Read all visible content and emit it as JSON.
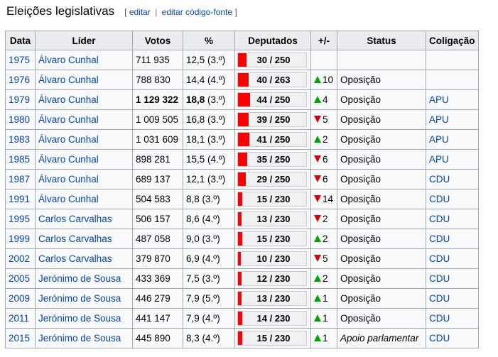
{
  "section": {
    "title": "Eleições legislativas",
    "edit_open": "[",
    "edit_label": "editar",
    "edit_sep": "|",
    "edit_source_label": "editar código-fonte",
    "edit_close": "]"
  },
  "colors": {
    "seat_bar": "#ff0000",
    "gain": "#00a600",
    "loss": "#dd0000",
    "link": "#0645ad"
  },
  "table": {
    "headers": [
      "Data",
      "Líder",
      "Votos",
      "%",
      "Deputados",
      "+/-",
      "Status",
      "Coligação"
    ],
    "rows": [
      {
        "year": "1975",
        "leader": "Álvaro Cunhal",
        "votes": "711 935",
        "pct": "12,5",
        "rank": "(3.º)",
        "seats": 30,
        "total": 250,
        "seats_label": "30 / 250",
        "change_dir": "",
        "change": "",
        "status": "",
        "coalition": ""
      },
      {
        "year": "1976",
        "leader": "Álvaro Cunhal",
        "votes": "788 830",
        "pct": "14,4",
        "rank": "(4.º)",
        "seats": 40,
        "total": 263,
        "seats_label": "40 / 263",
        "change_dir": "up",
        "change": "10",
        "status": "Oposição",
        "coalition": ""
      },
      {
        "year": "1979",
        "leader": "Álvaro Cunhal",
        "votes": "1 129 322",
        "pct": "18,8",
        "rank": "(3.º)",
        "seats": 44,
        "total": 250,
        "seats_label": "44 / 250",
        "change_dir": "up",
        "change": "4",
        "status": "Oposição",
        "coalition": "APU",
        "bold": true
      },
      {
        "year": "1980",
        "leader": "Álvaro Cunhal",
        "votes": "1 009 505",
        "pct": "16,8",
        "rank": "(3.º)",
        "seats": 39,
        "total": 250,
        "seats_label": "39 / 250",
        "change_dir": "down",
        "change": "5",
        "status": "Oposição",
        "coalition": "APU"
      },
      {
        "year": "1983",
        "leader": "Álvaro Cunhal",
        "votes": "1 031 609",
        "pct": "18,1",
        "rank": "(3.º)",
        "seats": 41,
        "total": 250,
        "seats_label": "41 / 250",
        "change_dir": "up",
        "change": "2",
        "status": "Oposição",
        "coalition": "APU"
      },
      {
        "year": "1985",
        "leader": "Álvaro Cunhal",
        "votes": "898 281",
        "pct": "15,5",
        "rank": "(4.º)",
        "seats": 35,
        "total": 250,
        "seats_label": "35 / 250",
        "change_dir": "down",
        "change": "6",
        "status": "Oposição",
        "coalition": "APU"
      },
      {
        "year": "1987",
        "leader": "Álvaro Cunhal",
        "votes": "689 137",
        "pct": "12,1",
        "rank": "(3.º)",
        "seats": 29,
        "total": 250,
        "seats_label": "29 / 250",
        "change_dir": "down",
        "change": "6",
        "status": "Oposição",
        "coalition": "CDU"
      },
      {
        "year": "1991",
        "leader": "Álvaro Cunhal",
        "votes": "504 583",
        "pct": "8,8",
        "rank": "(3.º)",
        "seats": 15,
        "total": 230,
        "seats_label": "15 / 230",
        "change_dir": "down",
        "change": "14",
        "status": "Oposição",
        "coalition": "CDU"
      },
      {
        "year": "1995",
        "leader": "Carlos Carvalhas",
        "votes": "506 157",
        "pct": "8,6",
        "rank": "(4.º)",
        "seats": 13,
        "total": 230,
        "seats_label": "13 / 230",
        "change_dir": "down",
        "change": "2",
        "status": "Oposição",
        "coalition": "CDU"
      },
      {
        "year": "1999",
        "leader": "Carlos Carvalhas",
        "votes": "487 058",
        "pct": "9,0",
        "rank": "(3.º)",
        "seats": 15,
        "total": 230,
        "seats_label": "15 / 230",
        "change_dir": "up",
        "change": "2",
        "status": "Oposição",
        "coalition": "CDU"
      },
      {
        "year": "2002",
        "leader": "Carlos Carvalhas",
        "votes": "379 870",
        "pct": "6,9",
        "rank": "(4.º)",
        "seats": 10,
        "total": 230,
        "seats_label": "10 / 230",
        "change_dir": "down",
        "change": "5",
        "status": "Oposição",
        "coalition": "CDU"
      },
      {
        "year": "2005",
        "leader": "Jerónimo de Sousa",
        "votes": "433 369",
        "pct": "7,5",
        "rank": "(3.º)",
        "seats": 12,
        "total": 230,
        "seats_label": "12 / 230",
        "change_dir": "up",
        "change": "2",
        "status": "Oposição",
        "coalition": "CDU"
      },
      {
        "year": "2009",
        "leader": "Jerónimo de Sousa",
        "votes": "446 279",
        "pct": "7,9",
        "rank": "(5.º)",
        "seats": 13,
        "total": 230,
        "seats_label": "13 / 230",
        "change_dir": "up",
        "change": "1",
        "status": "Oposição",
        "coalition": "CDU"
      },
      {
        "year": "2011",
        "leader": "Jerónimo de Sousa",
        "votes": "441 147",
        "pct": "7,9",
        "rank": "(4.º)",
        "seats": 14,
        "total": 230,
        "seats_label": "14 / 230",
        "change_dir": "up",
        "change": "1",
        "status": "Oposição",
        "coalition": "CDU"
      },
      {
        "year": "2015",
        "leader": "Jerónimo de Sousa",
        "votes": "445 890",
        "pct": "8,3",
        "rank": "(4.º)",
        "seats": 15,
        "total": 230,
        "seats_label": "15 / 230",
        "change_dir": "up",
        "change": "1",
        "status": "Apoio parlamentar",
        "status_italic": true,
        "coalition": "CDU"
      }
    ]
  }
}
